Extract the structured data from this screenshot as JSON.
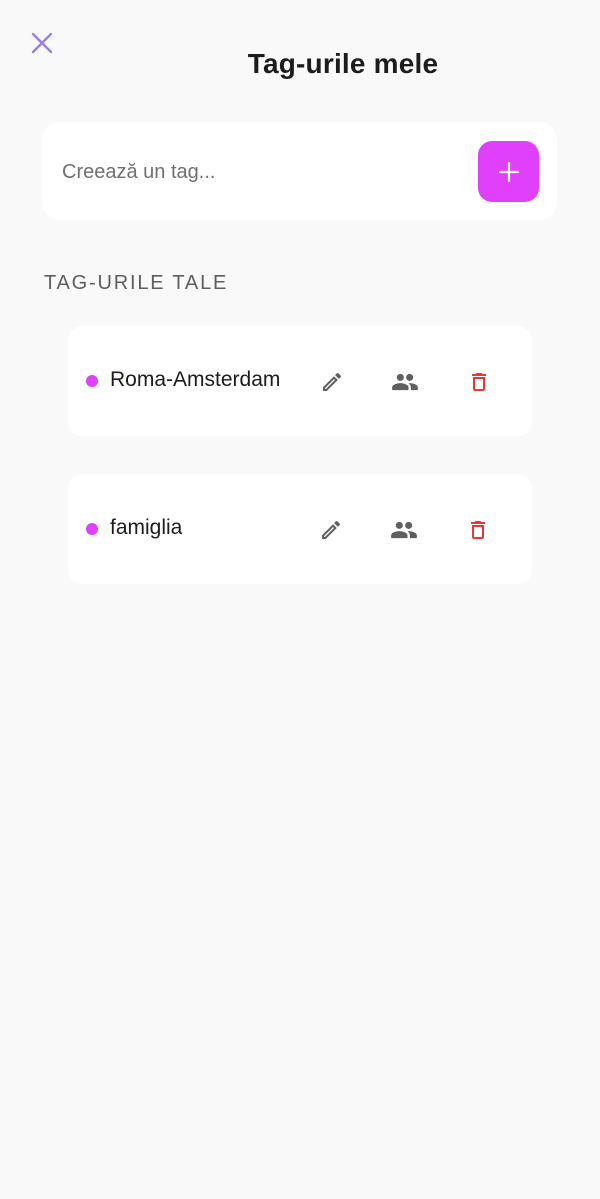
{
  "header": {
    "title": "Tag-urile mele",
    "close_icon": "close-icon",
    "close_color": "#9b7fe0"
  },
  "create": {
    "placeholder": "Creează un tag...",
    "value": "",
    "add_icon": "plus-icon",
    "add_color": "#e040fb"
  },
  "section": {
    "label": "TAG-URILE TALE"
  },
  "tags": [
    {
      "name": "Roma-Amsterdam",
      "dot_color": "#e040fb",
      "actions": [
        "edit-icon",
        "people-icon",
        "trash-icon"
      ]
    },
    {
      "name": "famiglia",
      "dot_color": "#e040fb",
      "actions": [
        "edit-icon",
        "people-icon",
        "trash-icon"
      ]
    }
  ],
  "colors": {
    "background": "#f9f9f9",
    "icon_gray": "#5f5f5f",
    "delete_red": "#e53935"
  }
}
